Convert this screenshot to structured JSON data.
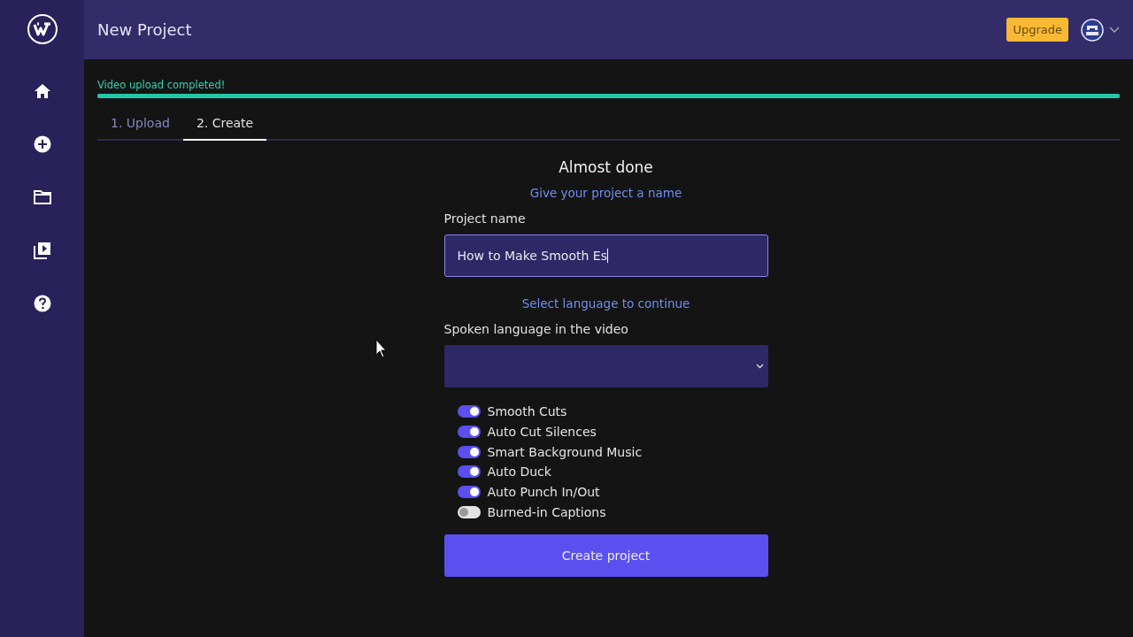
{
  "header": {
    "title": "New Project",
    "upgrade_label": "Upgrade"
  },
  "sidebar": {
    "items": [
      {
        "kind": "home"
      },
      {
        "kind": "add"
      },
      {
        "kind": "folder"
      },
      {
        "kind": "videos"
      },
      {
        "kind": "help"
      }
    ]
  },
  "upload_status": {
    "message": "Video upload completed!",
    "level": 1
  },
  "tabs": [
    {
      "label": "1. Upload",
      "selected": false
    },
    {
      "label": "2. Create",
      "selected": true
    }
  ],
  "form": {
    "heading": "Almost done",
    "subheading": "Give your project a name",
    "project_name_label": "Project name",
    "project_name_value": "How to Make Smooth Es",
    "language_hint": "Select language to continue",
    "language_label": "Spoken language in the video",
    "options": [
      {
        "label": "Smooth Cuts",
        "on": true
      },
      {
        "label": "Auto Cut Silences",
        "on": true
      },
      {
        "label": "Smart Background Music",
        "on": true
      },
      {
        "label": "Auto Duck",
        "on": true
      },
      {
        "label": "Auto Punch In/Out",
        "on": true
      },
      {
        "label": "Burned-in Captions",
        "on": false
      }
    ],
    "submit_label": "Create project"
  }
}
